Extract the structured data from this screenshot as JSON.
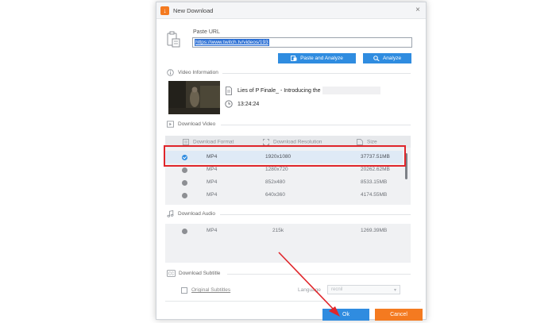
{
  "window": {
    "title": "New Download",
    "app_icon": "download-icon",
    "close_label": "×"
  },
  "paste": {
    "label": "Paste URL",
    "url_value": "https://www.twitch.tv/videos/193",
    "paste_analyze_label": "Paste and Analyze",
    "analyze_label": "Analyze"
  },
  "video_info": {
    "section_label": "Video Information",
    "title": "Lies of P Finale_ - Introducing the D",
    "duration": "13:24:24"
  },
  "download_video": {
    "section_label": "Download Video",
    "columns": [
      "Download Format",
      "Download Resolution",
      "Size"
    ],
    "rows": [
      {
        "format": "MP4",
        "resolution": "1920x1080",
        "size": "37737.51MB",
        "selected": true
      },
      {
        "format": "MP4",
        "resolution": "1280x720",
        "size": "20262.62MB",
        "selected": false
      },
      {
        "format": "MP4",
        "resolution": "852x480",
        "size": "8533.15MB",
        "selected": false
      },
      {
        "format": "MP4",
        "resolution": "640x360",
        "size": "4174.55MB",
        "selected": false
      }
    ]
  },
  "download_audio": {
    "section_label": "Download Audio",
    "rows": [
      {
        "format": "MP4",
        "bitrate": "215k",
        "size": "1269.39MB"
      }
    ]
  },
  "download_subtitle": {
    "section_label": "Download Subtitle",
    "checkbox_label": "Original Subtitles",
    "language_label": "Language",
    "language_value": "recnil"
  },
  "footer": {
    "ok_label": "Ok",
    "cancel_label": "Cancel"
  },
  "colors": {
    "accent_blue": "#2f8ce0",
    "accent_orange": "#f47a20",
    "highlight_red": "#e0262b"
  }
}
